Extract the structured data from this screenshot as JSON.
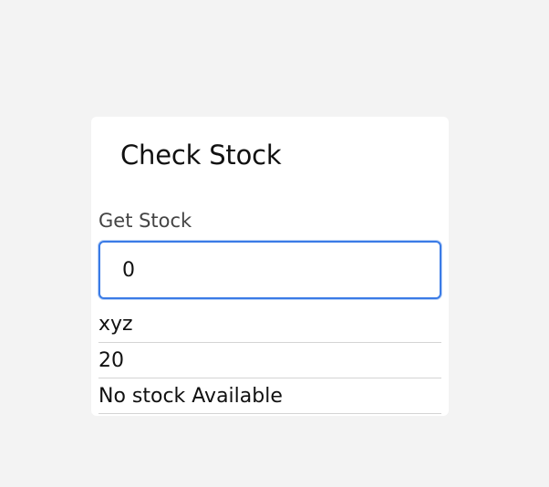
{
  "card": {
    "title": "Check Stock"
  },
  "form": {
    "label": "Get Stock",
    "input_value": "0"
  },
  "results": [
    "xyz",
    "20",
    "No stock Available"
  ],
  "colors": {
    "page_background": "#f3f3f3",
    "card_background": "#ffffff",
    "input_focus_border": "#3a7be6",
    "divider": "#d4d4d4"
  }
}
